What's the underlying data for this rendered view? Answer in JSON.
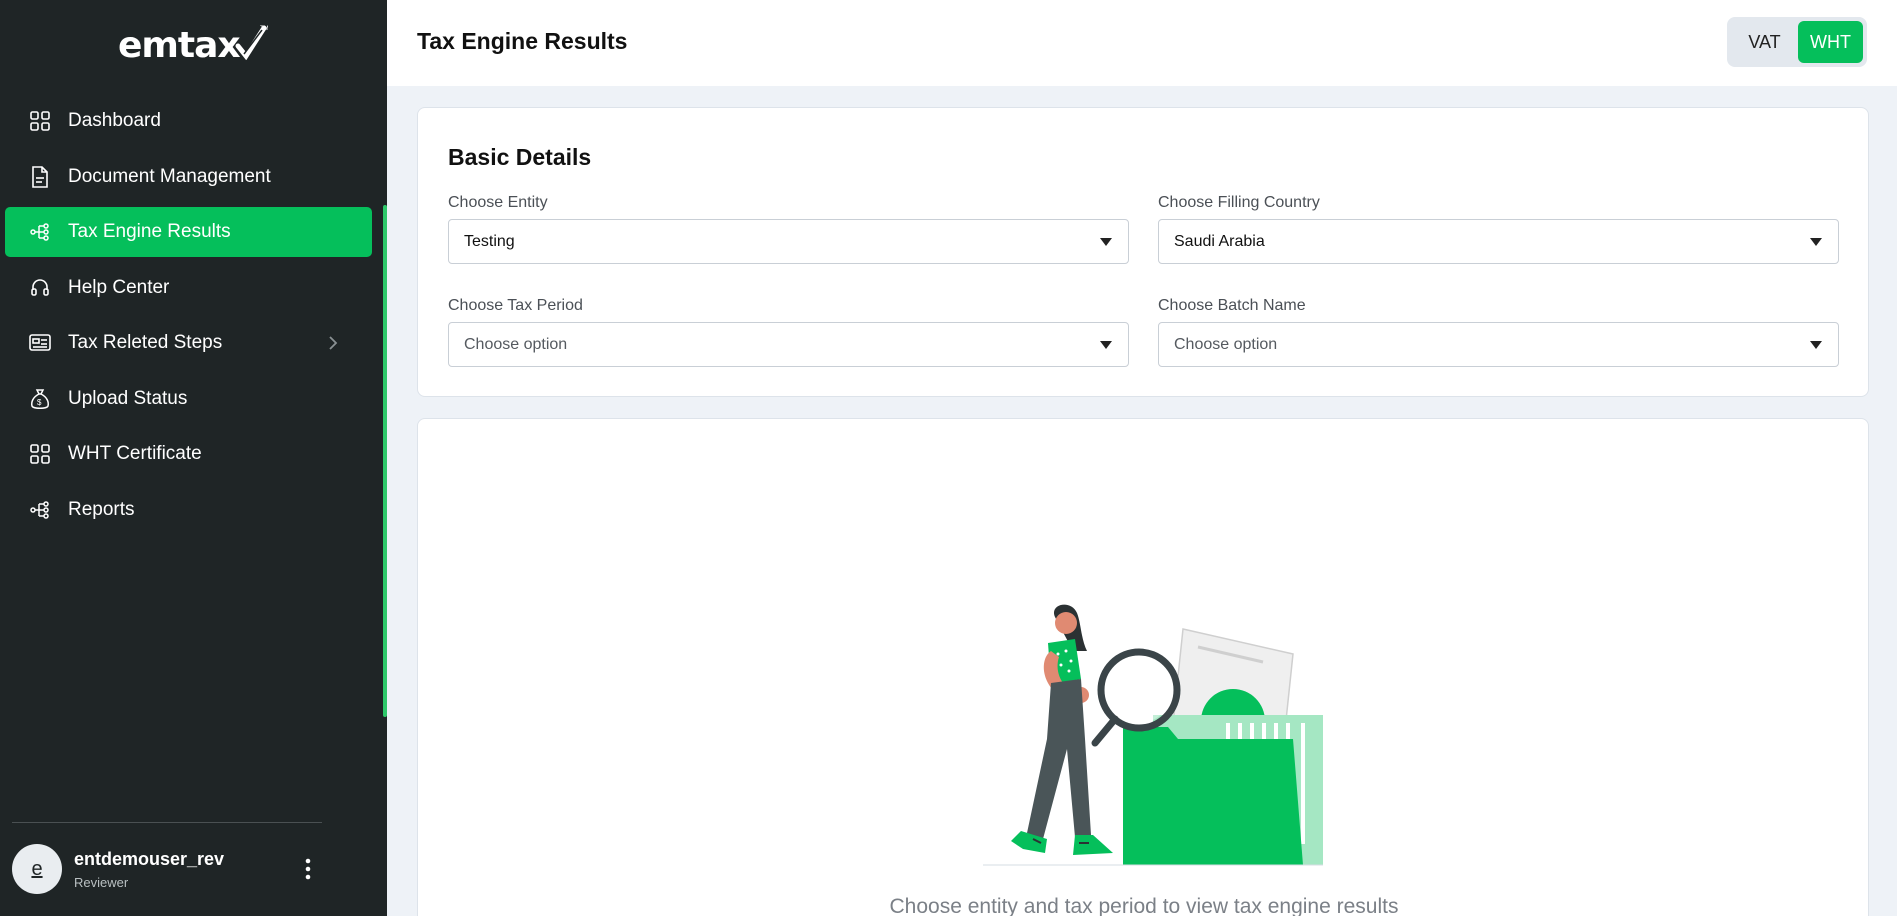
{
  "app": {
    "logo_text": "emtax",
    "brand_color": "#05bf5b",
    "sidebar_bg": "#1f2526"
  },
  "sidebar": {
    "items": [
      {
        "label": "Dashboard",
        "icon": "grid-icon",
        "active": false
      },
      {
        "label": "Document Management",
        "icon": "document-icon",
        "active": false
      },
      {
        "label": "Tax Engine Results",
        "icon": "hierarchy-icon",
        "active": true
      },
      {
        "label": "Help Center",
        "icon": "headset-icon",
        "active": false
      },
      {
        "label": "Tax Releted Steps",
        "icon": "list-card-icon",
        "active": false,
        "has_submenu": true
      },
      {
        "label": "Upload Status",
        "icon": "money-bag-icon",
        "active": false
      },
      {
        "label": "WHT Certificate",
        "icon": "grid-icon",
        "active": false
      },
      {
        "label": "Reports",
        "icon": "hierarchy-icon",
        "active": false
      }
    ]
  },
  "user": {
    "avatar_initial": "e",
    "name": "entdemouser_rev",
    "role": "Reviewer"
  },
  "header": {
    "title": "Tax Engine Results",
    "toggle": {
      "options": [
        "VAT",
        "WHT"
      ],
      "selected": "WHT"
    }
  },
  "basic_details": {
    "title": "Basic Details",
    "fields": [
      {
        "label": "Choose Entity",
        "value": "Testing"
      },
      {
        "label": "Choose Filling Country",
        "value": "Saudi Arabia"
      },
      {
        "label": "Choose Tax Period",
        "value": "Choose option"
      },
      {
        "label": "Choose Batch Name",
        "value": "Choose option"
      }
    ]
  },
  "results": {
    "empty_message": "Choose entity and tax period to view tax engine results"
  }
}
